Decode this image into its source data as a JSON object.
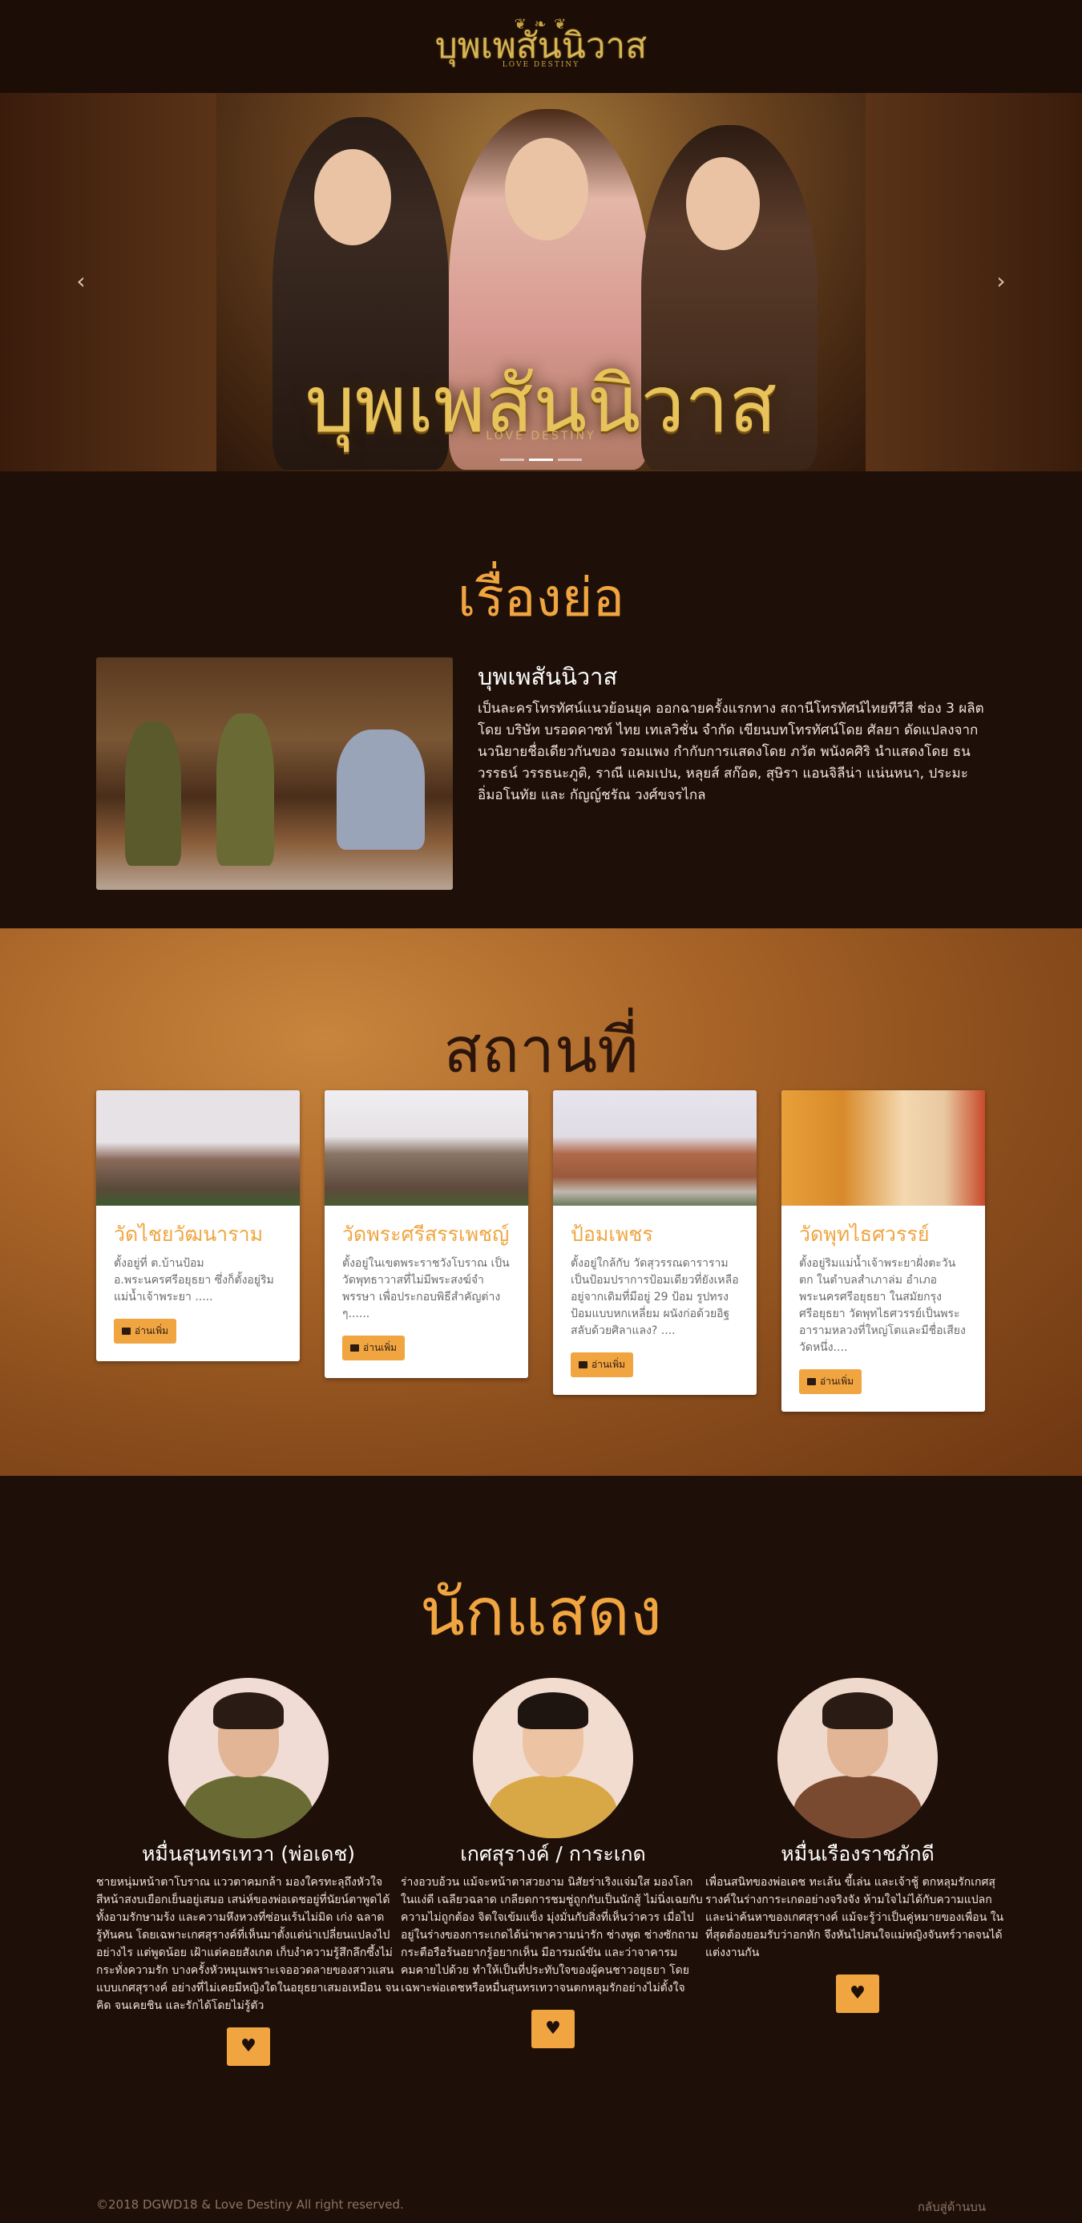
{
  "header": {
    "logo_text": "บุพเพสันนิวาส",
    "logo_sub": "LOVE DESTINY",
    "logo_ornament": "❦ ❧ ❦"
  },
  "hero": {
    "title": "บุพเพสันนิวาส",
    "subtitle": "LOVE DESTINY",
    "prev_icon": "‹",
    "next_icon": "›",
    "slides": 3,
    "active_slide": 1
  },
  "synopsis": {
    "section_title": "เรื่องย่อ",
    "heading": "บุพเพสันนิวาส",
    "text": "เป็นละครโทรทัศน์แนวย้อนยุค ออกฉายครั้งแรกทาง สถานีโทรทัศน์ไทยทีวีสี ช่อง 3 ผลิตโดย บริษัท บรอดคาซท์ ไทย เทเลวิชั่น จำกัด เขียนบทโทรทัศน์โดย ศัลยา ดัดแปลงจากนวนิยายชื่อเดียวกันของ รอมแพง กำกับการแสดงโดย ภวัต พนังคศิริ นำแสดงโดย ธนวรรธน์ วรรธนะภูติ, ราณี แคมเปน, หลุยส์ สก๊อต, สุษิรา แอนจิลีน่า แน่นหนา, ประมะ อิ่มอโนทัย และ กัญญ์ชรัณ วงศ์ขจรไกล"
  },
  "places": {
    "section_title": "สถานที่",
    "read_more_label": "อ่านเพิ่ม",
    "cards": [
      {
        "title": "วัดไชยวัฒนาราม",
        "text": "ตั้งอยู่ที่ ต.บ้านป้อม อ.พระนครศรีอยุธยา ซึ่งก็ตั้งอยู่ริม แม่น้ำเจ้าพระยา ....."
      },
      {
        "title": "วัดพระศรีสรรเพชญ์",
        "text": "ตั้งอยู่ในเขตพระราชวังโบราณ เป็นวัดพุทธาวาสที่ไม่มีพระสงฆ์จำพรรษา เพื่อประกอบพิธีสำคัญต่าง ๆ......"
      },
      {
        "title": "ป้อมเพชร",
        "text": "ตั้งอยู่ใกล้กับ วัดสุวรรณดาราราม เป็นป้อมปราการป้อมเดียวที่ยังเหลืออยู่จากเดิมที่มีอยู่ 29 ป้อม รูปทรงป้อมแบบหกเหลี่ยม ผนังก่อด้วยอิฐสลับด้วยศิลาแลง? ...."
      },
      {
        "title": "วัดพุทไธศวรรย์",
        "text": "ตั้งอยู่ริมแม่น้ำเจ้าพระยาฝั่งตะวันตก ในตำบลสำเภาล่ม อำเภอพระนครศรีอยุธยา ในสมัยกรุงศรีอยุธยา วัดพุทไธศวรรย์เป็นพระอารามหลวงที่ใหญ่โตและมีชื่อเสียงวัดหนึ่ง...."
      }
    ]
  },
  "cast": {
    "section_title": "นักแสดง",
    "heart_icon": "♥",
    "actors": [
      {
        "name": "หมื่นสุนทรเทวา (พ่อเดช)",
        "desc": "ชายหนุ่มหน้าตาโบราณ แววตาคมกล้า มองใครทะลุถึงหัวใจ สีหน้าสงบเยือกเย็นอยู่เสมอ เสน่ห์ของพ่อเดชอยู่ที่นัยน์ตาพูดได้ทั้งอามรักษามร้ง และความหึงหวงที่ซ่อนเร้นไม่มิด เก่ง ฉลาด รู้ทันคน โดยเฉพาะเกศสุรางค์ที่เห็นมาตั้งแต่น่าเปลี่ยนแปลงไปอย่างไร แต่พูดน้อย เฝ้าแต่คอยสังเกต เก็บงำความรู้สึกลึกซึ้งไม่กระทั่งความรัก บางครั้งหัวหมุนเพราะเจออวดลายของสาวแสนแบบเกศสุรางค์ อย่างที่ไม่เคยมีหญิงใดในอยุธยาเสมอเหมือน จนคิด จนเคยชิน และรักได้โดยไม่รู้ตัว"
      },
      {
        "name": "เกศสุรางค์ / การะเกด",
        "desc": "ร่างอวบอ้วน แม้จะหน้าตาสวยงาม นิสัยร่าเริงแจ่มใส มองโลกในแง่ดี เฉลียวฉลาด เกลียดการชมชู่ถูกกับเป็นนักสู้ ไม่นิ่งเฉยกับความไม่ถูกต้อง จิตใจเข้มแข็ง มุ่งมั่นกับสิ่งที่เห็นว่าควร เมื่อไปอยู่ในร่างของการะเกดได้น่าพาความน่ารัก ช่างพูด ช่างซักถาม กระตือรือร้นอยากรู้อยากเห็น มีอารมณ์ขัน และว่าจาคารมคมคายไปด้วย ทำให้เป็นที่ประทับใจของผู้คนชาวอยุธยา โดยเฉพาะพ่อเดชหรือหมื่นสุนทรเทวาจนตกหลุมรักอย่างไม่ตั้งใจ"
      },
      {
        "name": "หมื่นเรืองราชภักดี",
        "desc": "เพื่อนสนิทของพ่อเดช ทะเล้น ขี้เล่น และเจ้าชู้ ตกหลุมรักเกศสุรางค์ในร่างการะเกดอย่างจริงจัง ห้ามใจไม่ได้กับความแปลกและน่าค้นหาของเกศสุรางค์ แม้จะรู้ว่าเป็นคู่หมายของเพื่อน ในที่สุดต้องยอมรับว่าอกหัก จึงหันไปสนใจแม่หญิงจันทร์วาดจนได้แต่งงานกัน"
      }
    ]
  },
  "footer": {
    "copyright": "©2018 DGWD18 & Love Destiny All right reserved.",
    "back_to_top": "กลับสู่ด้านบน"
  },
  "colors": {
    "accent": "#f0a541",
    "background": "#1e0f08",
    "places_title": "#2c150a"
  }
}
